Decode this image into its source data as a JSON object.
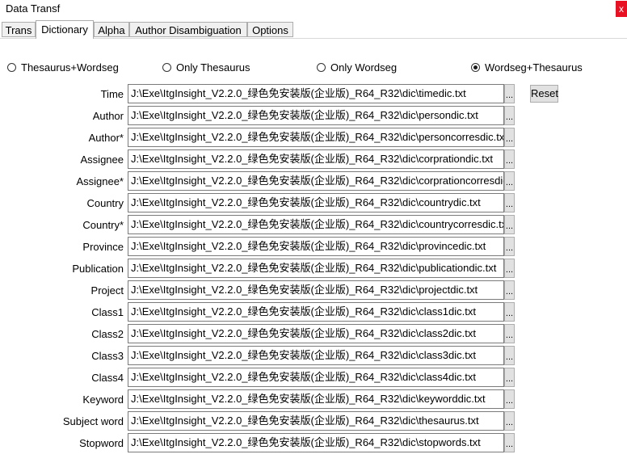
{
  "window": {
    "title": "Data Transf",
    "close_label": "x"
  },
  "tabs": [
    {
      "label": "Trans"
    },
    {
      "label": "Dictionary",
      "active": true
    },
    {
      "label": "Alpha"
    },
    {
      "label": "Author Disambiguation"
    },
    {
      "label": "Options"
    }
  ],
  "mode_options": [
    {
      "label": "Thesaurus+Wordseg",
      "checked": false
    },
    {
      "label": "Only Thesaurus",
      "checked": false
    },
    {
      "label": "Only Wordseg",
      "checked": false
    },
    {
      "label": "Wordseg+Thesaurus",
      "checked": true
    }
  ],
  "reset_label": "Reset",
  "browse_label": "...",
  "dictionaries": [
    {
      "label": "Time",
      "path": "J:\\Exe\\ItgInsight_V2.2.0_绿色免安装版(企业版)_R64_R32\\dic\\timedic.txt"
    },
    {
      "label": "Author",
      "path": "J:\\Exe\\ItgInsight_V2.2.0_绿色免安装版(企业版)_R64_R32\\dic\\persondic.txt"
    },
    {
      "label": "Author*",
      "path": "J:\\Exe\\ItgInsight_V2.2.0_绿色免安装版(企业版)_R64_R32\\dic\\personcorresdic.txt"
    },
    {
      "label": "Assignee",
      "path": "J:\\Exe\\ItgInsight_V2.2.0_绿色免安装版(企业版)_R64_R32\\dic\\corprationdic.txt"
    },
    {
      "label": "Assignee*",
      "path": "J:\\Exe\\ItgInsight_V2.2.0_绿色免安装版(企业版)_R64_R32\\dic\\corprationcorresdic.txt"
    },
    {
      "label": "Country",
      "path": "J:\\Exe\\ItgInsight_V2.2.0_绿色免安装版(企业版)_R64_R32\\dic\\countrydic.txt"
    },
    {
      "label": "Country*",
      "path": "J:\\Exe\\ItgInsight_V2.2.0_绿色免安装版(企业版)_R64_R32\\dic\\countrycorresdic.txt"
    },
    {
      "label": "Province",
      "path": "J:\\Exe\\ItgInsight_V2.2.0_绿色免安装版(企业版)_R64_R32\\dic\\provincedic.txt"
    },
    {
      "label": "Publication",
      "path": "J:\\Exe\\ItgInsight_V2.2.0_绿色免安装版(企业版)_R64_R32\\dic\\publicationdic.txt"
    },
    {
      "label": "Project",
      "path": "J:\\Exe\\ItgInsight_V2.2.0_绿色免安装版(企业版)_R64_R32\\dic\\projectdic.txt"
    },
    {
      "label": "Class1",
      "path": "J:\\Exe\\ItgInsight_V2.2.0_绿色免安装版(企业版)_R64_R32\\dic\\class1dic.txt"
    },
    {
      "label": "Class2",
      "path": "J:\\Exe\\ItgInsight_V2.2.0_绿色免安装版(企业版)_R64_R32\\dic\\class2dic.txt"
    },
    {
      "label": "Class3",
      "path": "J:\\Exe\\ItgInsight_V2.2.0_绿色免安装版(企业版)_R64_R32\\dic\\class3dic.txt"
    },
    {
      "label": "Class4",
      "path": "J:\\Exe\\ItgInsight_V2.2.0_绿色免安装版(企业版)_R64_R32\\dic\\class4dic.txt"
    },
    {
      "label": "Keyword",
      "path": "J:\\Exe\\ItgInsight_V2.2.0_绿色免安装版(企业版)_R64_R32\\dic\\keyworddic.txt"
    },
    {
      "label": "Subject word",
      "path": "J:\\Exe\\ItgInsight_V2.2.0_绿色免安装版(企业版)_R64_R32\\dic\\thesaurus.txt"
    },
    {
      "label": "Stopword",
      "path": "J:\\Exe\\ItgInsight_V2.2.0_绿色免安装版(企业版)_R64_R32\\dic\\stopwords.txt"
    }
  ]
}
